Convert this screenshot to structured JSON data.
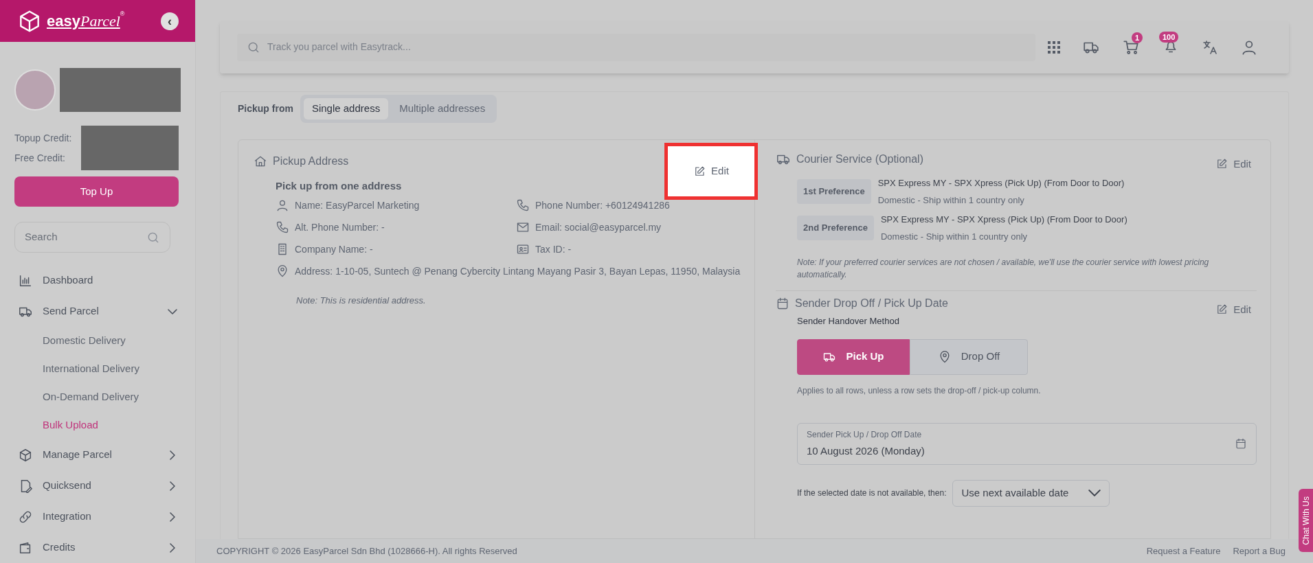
{
  "sidebar": {
    "logo": {
      "word_bold": "easy",
      "word_script": "Parcel",
      "mark": "®"
    },
    "collapse_button": "‹",
    "profile": {
      "credit_labels": [
        "Topup Credit:",
        "Free Credit:"
      ]
    },
    "top_up_button": "Top Up",
    "search": {
      "placeholder": "Search"
    },
    "nav": [
      {
        "label": "Dashboard",
        "kind": "link",
        "selected": false
      },
      {
        "label": "Send Parcel",
        "kind": "group",
        "expanded": true,
        "selected": false,
        "children": [
          {
            "label": "Domestic Delivery",
            "selected": false
          },
          {
            "label": "International Delivery",
            "selected": false
          },
          {
            "label": "On-Demand Delivery",
            "selected": false
          },
          {
            "label": "Bulk Upload",
            "selected": true
          }
        ]
      },
      {
        "label": "Manage Parcel",
        "kind": "group",
        "expanded": false,
        "selected": false
      },
      {
        "label": "Quicksend",
        "kind": "group",
        "expanded": false,
        "selected": false
      },
      {
        "label": "Integration",
        "kind": "group",
        "expanded": false,
        "selected": false
      },
      {
        "label": "Credits",
        "kind": "group",
        "expanded": false,
        "selected": false
      }
    ]
  },
  "topbar": {
    "search": {
      "placeholder": "Track you parcel with Easytrack..."
    },
    "cart_badge": "1",
    "notification_badge": "100"
  },
  "pickup_from": {
    "label": "Pickup from",
    "tabs": [
      {
        "label": "Single address",
        "selected": true
      },
      {
        "label": "Multiple addresses",
        "selected": false
      }
    ]
  },
  "pickup_address": {
    "title": "Pickup Address",
    "edit": "Edit",
    "edit_highlighted": true,
    "subtitle": "Pick up from one address",
    "fields": [
      {
        "kind": "person",
        "text": "Name: EasyParcel Marketing"
      },
      {
        "kind": "phone",
        "text": "Phone Number: +60124941286"
      },
      {
        "kind": "phone",
        "text": "Alt. Phone Number: -"
      },
      {
        "kind": "mail",
        "text": "Email: social@easyparcel.my"
      },
      {
        "kind": "building",
        "text": "Company Name: -"
      },
      {
        "kind": "id",
        "text": "Tax ID: -"
      },
      {
        "kind": "pin",
        "text": "Address: 1-10-05, Suntech @ Penang Cybercity Lintang Mayang Pasir 3, Bayan Lepas, 11950, Malaysia"
      }
    ],
    "note": "Note: This is residential address."
  },
  "courier_service": {
    "title": "Courier Service (Optional)",
    "edit": "Edit",
    "preferences": [
      {
        "badge": "1st Preference",
        "service": "SPX Express MY - SPX Xpress (Pick Up) (From Door to Door)",
        "description": "Domestic - Ship within 1 country only"
      },
      {
        "badge": "2nd Preference",
        "service": "SPX Express MY - SPX Xpress (Pick Up) (From Door to Door)",
        "description": "Domestic - Ship within 1 country only"
      }
    ],
    "note": "Note: If your preferred courier services are not chosen / available, we'll use the courier service with lowest pricing automatically."
  },
  "sender_date": {
    "title": "Sender Drop Off / Pick Up Date",
    "edit": "Edit",
    "handover_label": "Sender Handover Method",
    "methods": [
      {
        "kind": "pickup",
        "label": "Pick Up",
        "selected": true
      },
      {
        "kind": "dropoff",
        "label": "Drop Off",
        "selected": false
      }
    ],
    "hint": "Applies to all rows, unless a row sets the drop-off / pick-up column.",
    "date_field": {
      "label": "Sender Pick Up / Drop Off Date",
      "value": "10 August 2026 (Monday)"
    },
    "fallback": {
      "label": "If the selected date is not available, then:",
      "value": "Use next available date"
    }
  },
  "footer": {
    "copyright": "COPYRIGHT © 2026 EasyParcel Sdn Bhd (1028666-H). All rights Reserved",
    "links": [
      "Request a Feature",
      "Report a Bug"
    ]
  },
  "chat_button": "Chat With Us"
}
